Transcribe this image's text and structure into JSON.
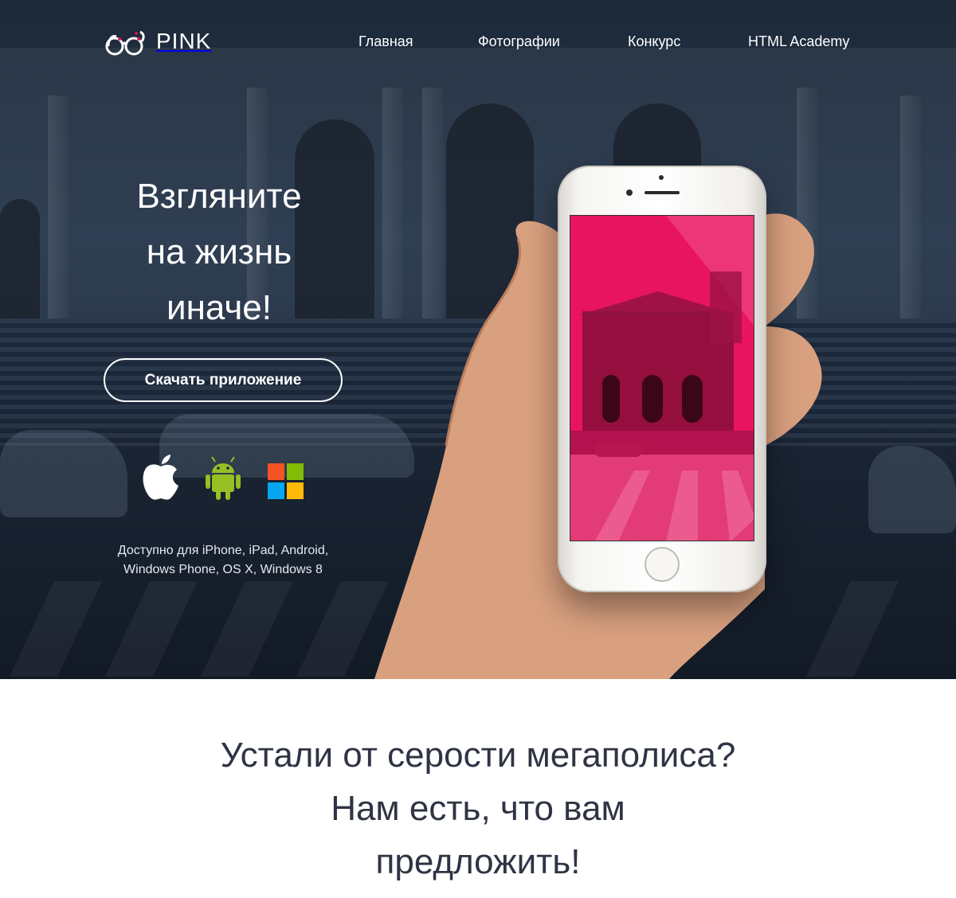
{
  "header": {
    "logo_text": "PINK",
    "nav": [
      "Главная",
      "Фотографии",
      "Конкурс",
      "HTML Academy"
    ]
  },
  "hero": {
    "headline": [
      "Взгляните",
      "на жизнь",
      "иначе!"
    ],
    "download_label": "Скачать приложение",
    "platforms": [
      "apple-icon",
      "android-icon",
      "windows-icon"
    ],
    "availability": [
      "Доступно для iPhone, iPad, Android,",
      "Windows Phone, OS X, Windows 8"
    ]
  },
  "promo": {
    "title": [
      "Устали от серости мегаполиса?",
      "Нам есть, что вам",
      "предложить!"
    ]
  },
  "colors": {
    "accent": "#e8145f",
    "hero_bg": "#1d2a3a",
    "text_dark": "#2f3444",
    "android": "#97c024"
  }
}
